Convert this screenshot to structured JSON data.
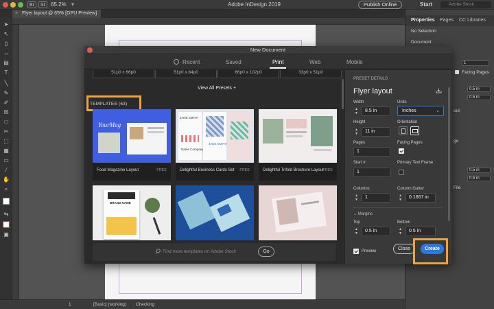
{
  "app": {
    "title": "Adobe InDesign 2019",
    "icons": [
      "Br",
      "St"
    ],
    "zoom": "65.2%",
    "publish_label": "Publish Online",
    "workspace": "Start",
    "search_placeholder": "Adobe Stock"
  },
  "document_tab": "Flyer layout @ 65% [GPU Preview]",
  "right_panel": {
    "tabs": [
      "Properties",
      "Pages",
      "CC Libraries"
    ],
    "no_selection": "No Selection",
    "document_label": "Document",
    "pages_value": "1",
    "facing_pages_label": "Facing Pages",
    "values": [
      "0.5 in",
      "0.5 in",
      "0.5 in",
      "0.5 in"
    ],
    "layout_label": "out",
    "ge_label": "ge",
    "file_label": "File"
  },
  "status_bar": {
    "page_style": "[Basic] (working)",
    "preflight": "Checking"
  },
  "dialog": {
    "title": "New Document",
    "tabs": [
      "Recent",
      "Saved",
      "Print",
      "Web",
      "Mobile"
    ],
    "active_tab": "Print",
    "preset_cards": [
      "51p0 x 66p0",
      "51p0 x 84p0",
      "66p0 x 102p0",
      "33p0 x 51p0"
    ],
    "view_all": "View All Presets +",
    "templates_header": "TEMPLATES  (63)",
    "templates": [
      {
        "name": "Food Magazine Layout",
        "badge": "FREE"
      },
      {
        "name": "Delightful Business Cards Set",
        "badge": "FREE"
      },
      {
        "name": "Delightful Trifold Brochure Layout",
        "badge": "FREE"
      },
      {
        "name": "",
        "badge": ""
      },
      {
        "name": "",
        "badge": ""
      },
      {
        "name": "",
        "badge": ""
      }
    ],
    "thumb_text": {
      "magazine": "YourMag",
      "card_name": "JANE SMITH",
      "card_company": "Name Company",
      "card_jane": "JANE SMITH",
      "brand": "BRAND NAME"
    },
    "search_placeholder": "Find more templates on Adobe Stock",
    "go_label": "Go",
    "preset_details": {
      "header": "PRESET DETAILS",
      "name": "Flyer layout",
      "width_label": "Width",
      "width": "8.5 in",
      "units_label": "Units",
      "units": "Inches",
      "height_label": "Height",
      "height": "11 in",
      "orientation_label": "Orientation",
      "pages_label": "Pages",
      "pages": "1",
      "facing_pages_label": "Facing Pages",
      "facing_pages": true,
      "start_label": "Start #",
      "start": "1",
      "primary_text_frame_label": "Primary Text Frame",
      "primary_text_frame": false,
      "columns_label": "Columns",
      "columns": "1",
      "column_gutter_label": "Column Gutter",
      "column_gutter": "0.1667 in",
      "margins_label": "Margins",
      "top_label": "Top",
      "top": "0.5 in",
      "bottom_label": "Bottom",
      "bottom": "0.5 in"
    },
    "preview_label": "Preview",
    "preview_checked": true,
    "close_label": "Close",
    "create_label": "Create"
  },
  "colors": {
    "accent_blue": "#2f77df",
    "highlight_orange": "#f0a33c",
    "page_margin": "#c7a4e3"
  }
}
